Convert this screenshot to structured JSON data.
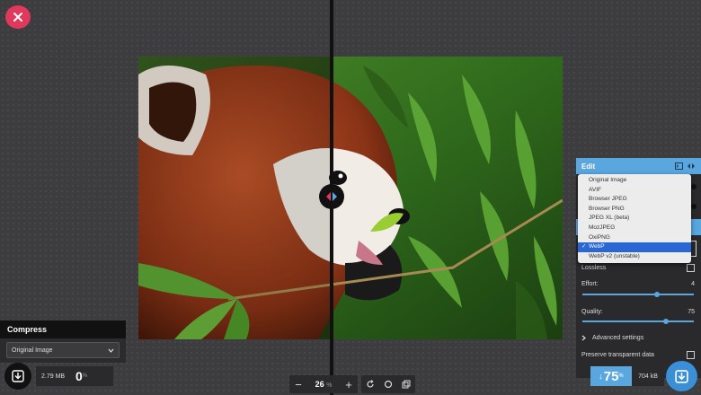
{
  "app": {
    "close_label": "Close"
  },
  "toolbar": {
    "zoom_value": "26",
    "zoom_unit": "%",
    "zoom_out": "−",
    "zoom_in": "+"
  },
  "left": {
    "title": "Compress",
    "format": "Original Image",
    "size": "2.79 MB",
    "percent": "0",
    "percent_unit": "%"
  },
  "right": {
    "title": "Edit",
    "options": [
      "Original Image",
      "AVIF",
      "Browser JPEG",
      "Browser PNG",
      "JPEG XL (beta)",
      "MozJPEG",
      "OxiPNG",
      "WebP",
      "WebP v2 (unstable)"
    ],
    "selected_index": 7,
    "lossless_label": "Lossless",
    "effort_label": "Effort:",
    "effort_value": "4",
    "effort_fraction": 0.67,
    "quality_label": "Quality:",
    "quality_value": "75",
    "quality_fraction": 0.75,
    "advanced_label": "Advanced settings",
    "preserve_label": "Preserve transparent data",
    "reduction": "75",
    "reduction_arrow": "↓",
    "reduction_unit": "%",
    "size": "704 kB"
  },
  "colors": {
    "accent": "#5aa7e0",
    "close": "#e0395b",
    "selected": "#2a67d3"
  }
}
